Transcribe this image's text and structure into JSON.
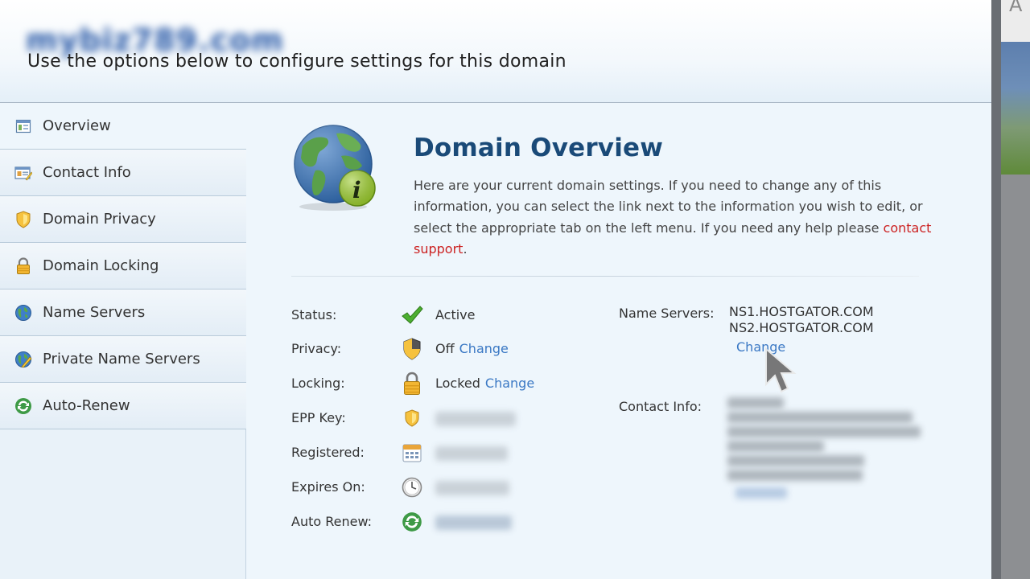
{
  "header": {
    "domain_name": "mybiz789.com",
    "subtitle": "Use the options below to configure settings for this domain"
  },
  "sidebar": {
    "items": [
      {
        "label": "Overview",
        "icon": "overview-icon",
        "active": true
      },
      {
        "label": "Contact Info",
        "icon": "contact-card-icon",
        "active": false
      },
      {
        "label": "Domain Privacy",
        "icon": "shield-icon",
        "active": false
      },
      {
        "label": "Domain Locking",
        "icon": "padlock-icon",
        "active": false
      },
      {
        "label": "Name Servers",
        "icon": "globe-icon",
        "active": false
      },
      {
        "label": "Private Name Servers",
        "icon": "globe-pencil-icon",
        "active": false
      },
      {
        "label": "Auto-Renew",
        "icon": "renew-arrows-icon",
        "active": false
      }
    ]
  },
  "main": {
    "title": "Domain Overview",
    "intro_text": "Here are your current domain settings. If you need to change any of this information, you can select the link next to the information you wish to edit, or select the appropriate tab on the left menu. If you need any help please ",
    "intro_link": "contact support",
    "intro_end": ".",
    "rows": [
      {
        "label": "Status:",
        "value": "Active",
        "link": "",
        "icon": "checkmark-icon"
      },
      {
        "label": "Privacy:",
        "value": "Off",
        "link": "Change",
        "icon": "shield-icon"
      },
      {
        "label": "Locking:",
        "value": "Locked",
        "link": "Change",
        "icon": "padlock-icon"
      },
      {
        "label": "EPP Key:",
        "value": "",
        "link": "",
        "icon": "shield-small-icon"
      },
      {
        "label": "Registered:",
        "value": "",
        "link": "",
        "icon": "calendar-icon"
      },
      {
        "label": "Expires On:",
        "value": "",
        "link": "",
        "icon": "clock-icon"
      },
      {
        "label": "Auto Renew:",
        "value": "",
        "link": "",
        "icon": "renew-arrows-icon"
      }
    ],
    "name_servers": {
      "label": "Name Servers:",
      "servers": [
        "NS1.HOSTGATOR.COM",
        "NS2.HOSTGATOR.COM"
      ],
      "change_label": "Change"
    },
    "contact_info": {
      "label": "Contact Info:"
    }
  },
  "background_app": {
    "visible_text": "A"
  },
  "colors": {
    "title": "#1a4a78",
    "link": "#3a78c4",
    "support_link": "#cc2222",
    "check": "#4caf30"
  }
}
